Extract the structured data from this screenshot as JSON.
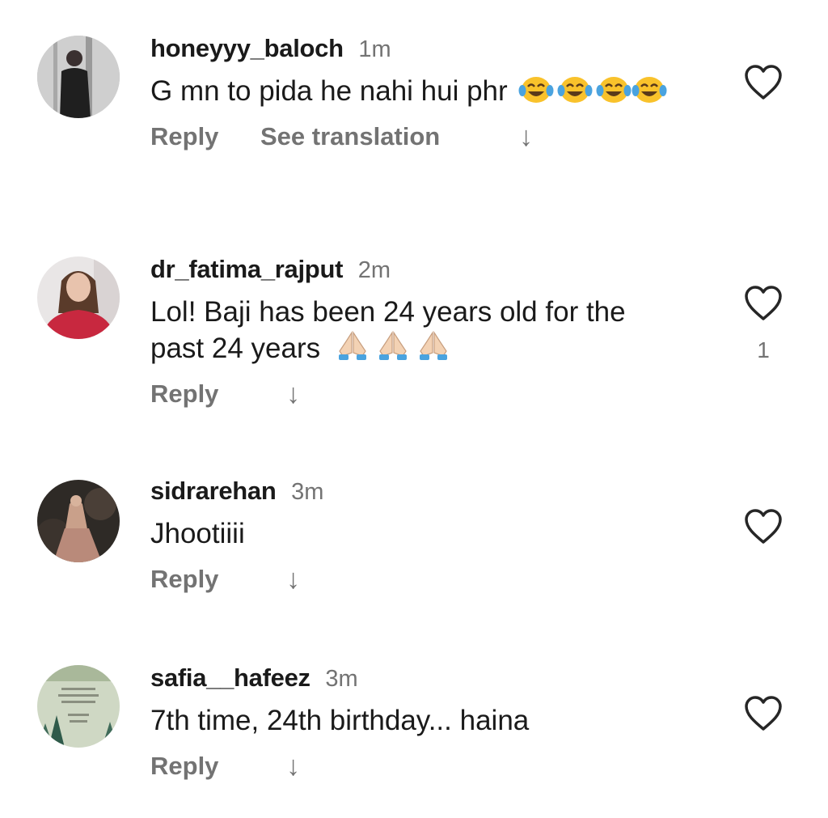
{
  "comments": [
    {
      "username": "honeyyy_baloch",
      "time": "1m",
      "text": "G mn to pida he nahi hui phr",
      "emoji": [
        "face-with-tears-of-joy",
        "face-with-tears-of-joy",
        "face-with-tears-of-joy",
        "face-with-tears-of-joy"
      ],
      "reply_label": "Reply",
      "translation_label": "See translation",
      "like_count": ""
    },
    {
      "username": "dr_fatima_rajput",
      "time": "2m",
      "text": "Lol! Baji has been 24 years old for the past 24 years",
      "emoji": [
        "folded-hands",
        "folded-hands",
        "folded-hands"
      ],
      "reply_label": "Reply",
      "like_count": "1"
    },
    {
      "username": "sidrarehan",
      "time": "3m",
      "text": "Jhootiiii",
      "reply_label": "Reply",
      "like_count": ""
    },
    {
      "username": "safia__hafeez",
      "time": "3m",
      "text": "7th time, 24th birthday... haina",
      "reply_label": "Reply",
      "like_count": ""
    }
  ],
  "icons": {
    "like": "heart-outline-icon",
    "more_replies": "arrow-down-icon"
  },
  "colors": {
    "text": "#1a1a1a",
    "secondary": "#737373",
    "emoji_yellow": "#f9c22b",
    "emoji_tear": "#4aa3df"
  }
}
